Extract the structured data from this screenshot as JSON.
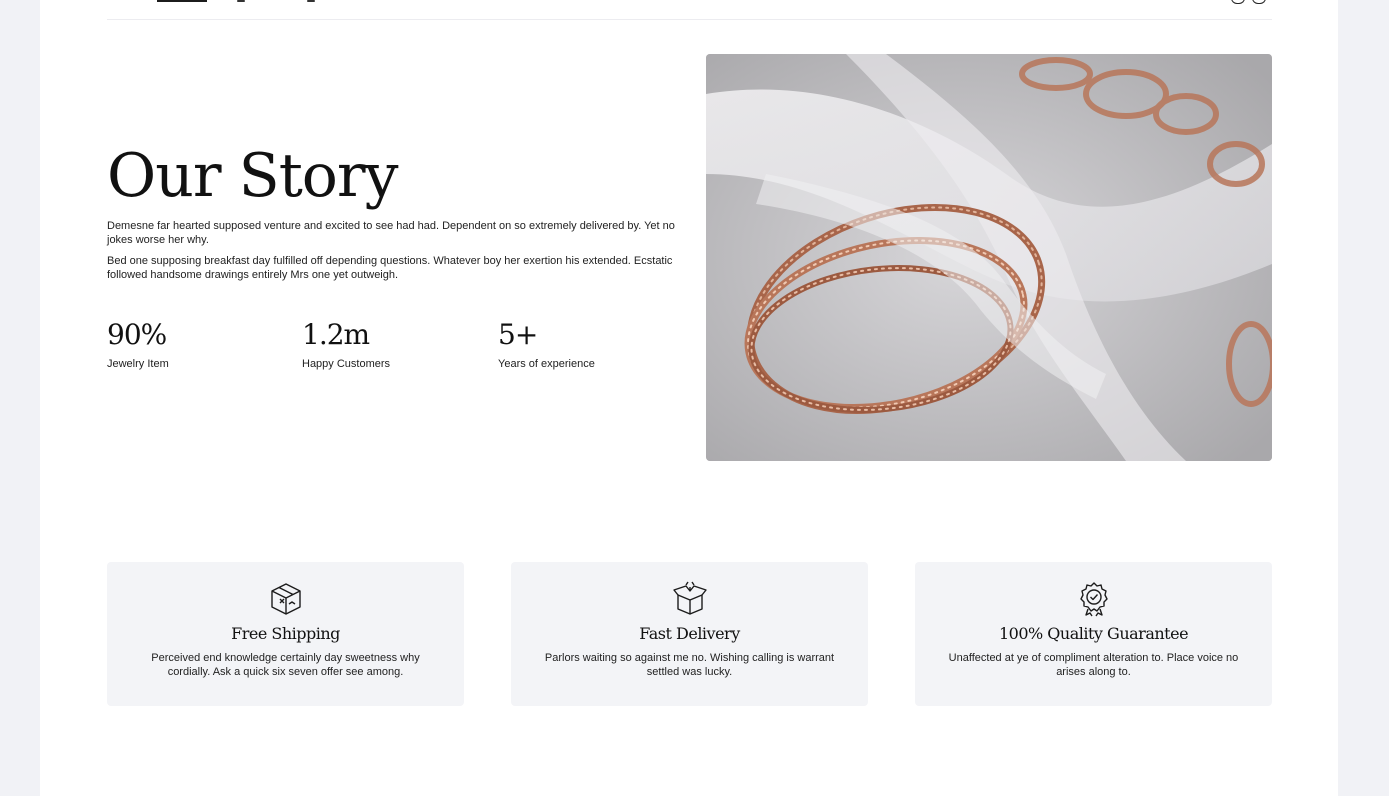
{
  "story": {
    "title": "Our Story",
    "paragraph_1": "Demesne far hearted supposed venture and excited to see had had. Dependent on so extremely delivered by. Yet no jokes worse her why.",
    "paragraph_2": "Bed one supposing breakfast day fulfilled off depending questions. Whatever boy her exertion his extended. Ecstatic followed handsome drawings entirely Mrs one yet outweigh."
  },
  "stats": [
    {
      "value": "90%",
      "label": "Jewelry Item"
    },
    {
      "value": "1.2m",
      "label": "Happy Customers"
    },
    {
      "value": "5+",
      "label": "Years of experience"
    }
  ],
  "features": [
    {
      "icon": "box-icon",
      "title": "Free Shipping",
      "text": "Perceived end knowledge certainly day sweetness why cordially. Ask a quick six seven offer see among."
    },
    {
      "icon": "open-box-icon",
      "title": "Fast Delivery",
      "text": "Parlors waiting so against me no. Wishing calling is warrant settled was lucky."
    },
    {
      "icon": "badge-check-icon",
      "title": "100% Quality Guarantee",
      "text": "Unaffected at ye of compliment alteration to. Place voice no arises along to."
    }
  ],
  "colors": {
    "background": "#f1f2f6",
    "page": "#ffffff",
    "card": "#f3f4f7",
    "text": "#1c1c1c",
    "rose_gold": "#b8765a"
  }
}
